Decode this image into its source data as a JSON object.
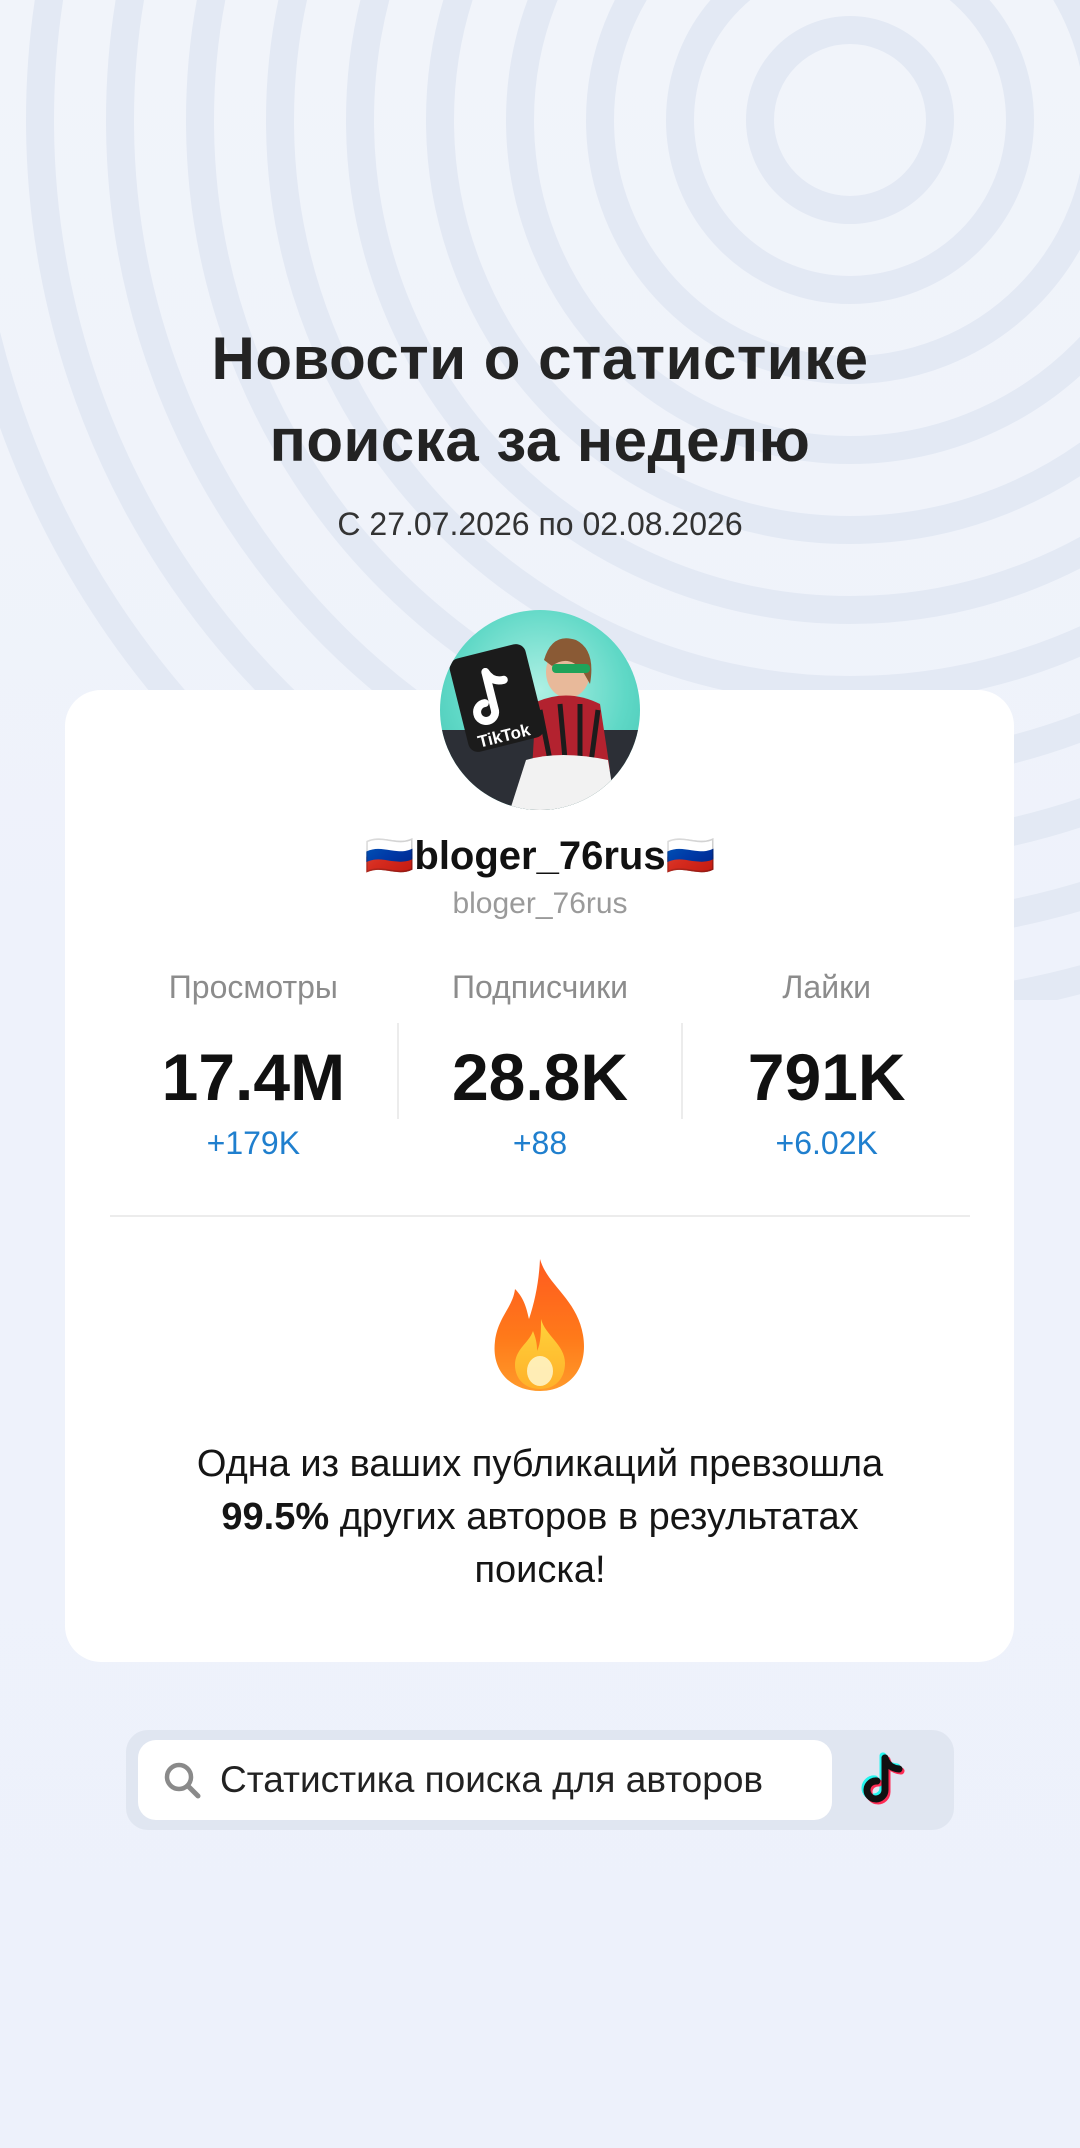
{
  "header": {
    "title_line1": "Новости о статистике",
    "title_line2": "поиска за неделю",
    "date_range": "С 27.07.2026 по 02.08.2026"
  },
  "profile": {
    "display_name": "🇷🇺bloger_76rus🇷🇺",
    "handle": "bloger_76rus",
    "avatar_text": "TikTok"
  },
  "stats": [
    {
      "label": "Просмотры",
      "value": "17.4M",
      "delta": "+179K"
    },
    {
      "label": "Подписчики",
      "value": "28.8K",
      "delta": "+88"
    },
    {
      "label": "Лайки",
      "value": "791K",
      "delta": "+6.02K"
    }
  ],
  "message": {
    "line1": "Одна из ваших публикаций превзошла",
    "percent": "99.5%",
    "line2": " других авторов в результатах",
    "line3": "поиска!"
  },
  "search": {
    "label": "Статистика поиска для авторов",
    "icon": "search-icon",
    "brand_icon": "tiktok-logo-icon"
  },
  "colors": {
    "accent_blue": "#1f7fce",
    "background": "#eef2fb",
    "card": "#ffffff"
  }
}
